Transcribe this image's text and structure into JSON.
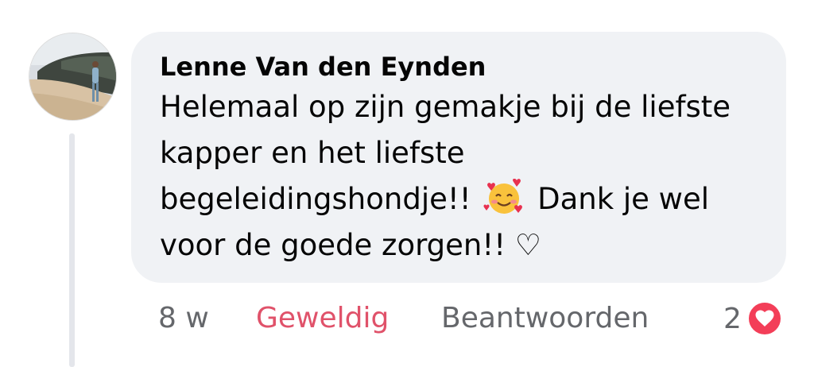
{
  "comment": {
    "author": "Lenne Van den Eynden",
    "text_before_emoji": "Helemaal op zijn gemakje bij de liefste kapper en het liefste begeleidingshondje!!",
    "emoji": "smiling-face-with-hearts",
    "text_after_emoji": "Dank je wel voor de goede zorgen!! ♡",
    "time": "8 w",
    "reaction_label": "Geweldig",
    "reply_label": "Beantwoorden",
    "reaction_count": "2",
    "reaction_icon": "heart-icon",
    "colors": {
      "bubble": "#f0f2f5",
      "reaction_link": "#e0526a",
      "love_reaction": "#f33e58",
      "meta_text": "#65676b"
    }
  }
}
